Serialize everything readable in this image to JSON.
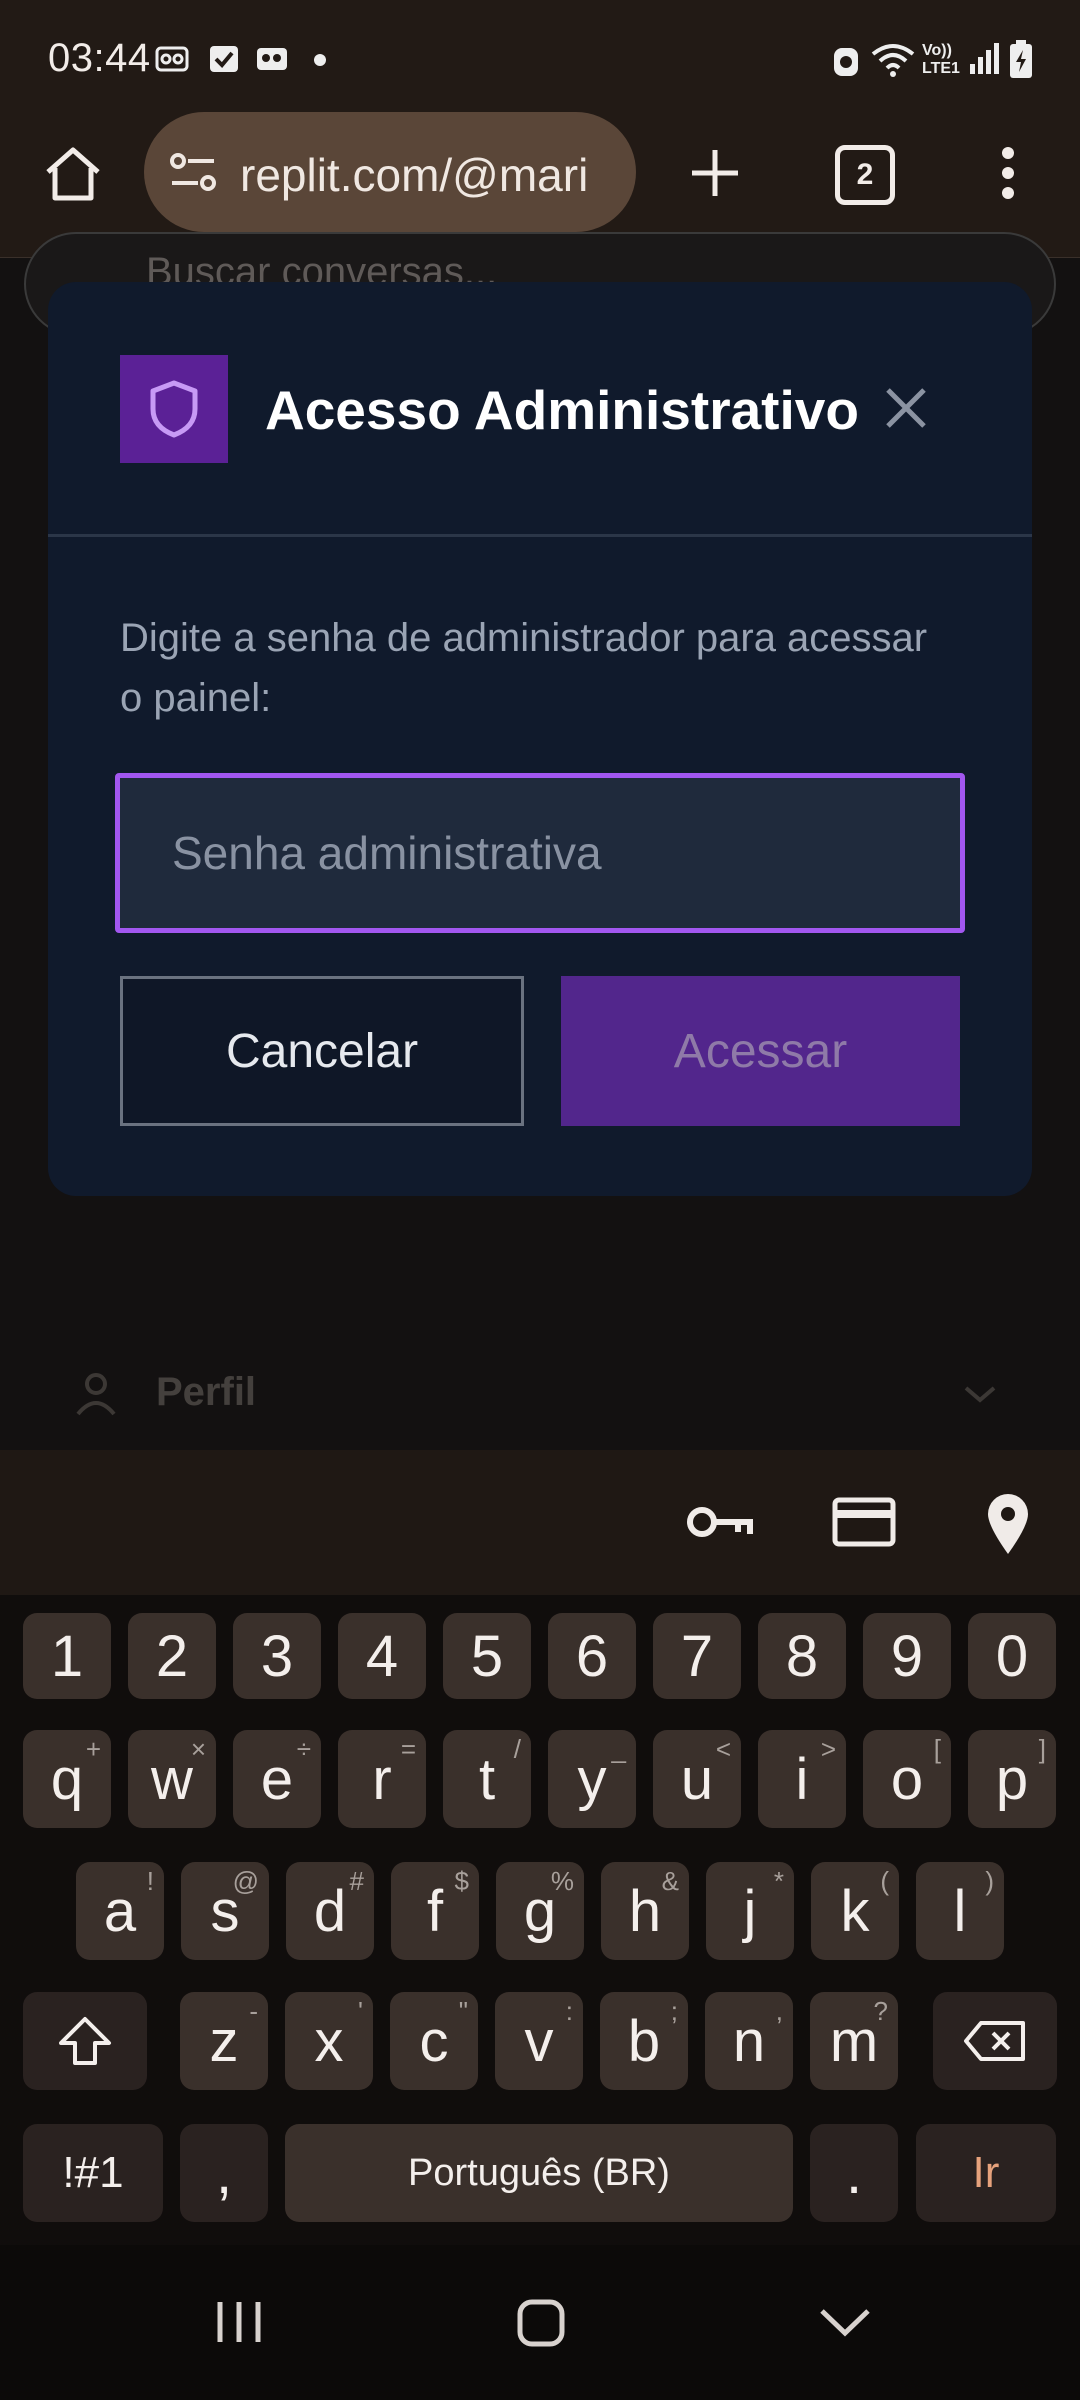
{
  "status_bar": {
    "time": "03:44",
    "left_icons": [
      "voicemail-icon",
      "checkbox-icon",
      "voicemail-alt-icon",
      "dot-icon"
    ],
    "right_icons": [
      "alarm-icon",
      "wifi-icon",
      "volte-icon",
      "signal-icon",
      "battery-charging-icon"
    ],
    "volte_label": "Vo)) LTE1"
  },
  "browser": {
    "url": "replit.com/@mari",
    "tab_count": "2",
    "icons": [
      "home-icon",
      "site-settings-icon",
      "new-tab-icon",
      "tab-switcher-icon",
      "more-menu-icon"
    ]
  },
  "page": {
    "search_placeholder": "Buscar conversas...",
    "profile_label": "Perfil"
  },
  "modal": {
    "title": "Acesso Administrativo",
    "description": "Digite a senha de administrador para acessar o painel:",
    "password_placeholder": "Senha administrativa",
    "cancel_label": "Cancelar",
    "access_label": "Acessar",
    "accent": "#5b2196",
    "input_border": "#a257f0"
  },
  "keyboard": {
    "number_row": [
      "1",
      "2",
      "3",
      "4",
      "5",
      "6",
      "7",
      "8",
      "9",
      "0"
    ],
    "row1": [
      {
        "key": "q",
        "hint": "+"
      },
      {
        "key": "w",
        "hint": "×"
      },
      {
        "key": "e",
        "hint": "÷"
      },
      {
        "key": "r",
        "hint": "="
      },
      {
        "key": "t",
        "hint": "/"
      },
      {
        "key": "y",
        "hint": "_"
      },
      {
        "key": "u",
        "hint": "<"
      },
      {
        "key": "i",
        "hint": ">"
      },
      {
        "key": "o",
        "hint": "["
      },
      {
        "key": "p",
        "hint": "]"
      }
    ],
    "row2": [
      {
        "key": "a",
        "hint": "!"
      },
      {
        "key": "s",
        "hint": "@"
      },
      {
        "key": "d",
        "hint": "#"
      },
      {
        "key": "f",
        "hint": "$"
      },
      {
        "key": "g",
        "hint": "%"
      },
      {
        "key": "h",
        "hint": "&"
      },
      {
        "key": "j",
        "hint": "*"
      },
      {
        "key": "k",
        "hint": "("
      },
      {
        "key": "l",
        "hint": ")"
      }
    ],
    "row3": [
      {
        "key": "z",
        "hint": "-"
      },
      {
        "key": "x",
        "hint": "'"
      },
      {
        "key": "c",
        "hint": "\""
      },
      {
        "key": "v",
        "hint": ":"
      },
      {
        "key": "b",
        "hint": ";"
      },
      {
        "key": "n",
        "hint": ","
      },
      {
        "key": "m",
        "hint": "?"
      }
    ],
    "symbols_label": "!#1",
    "comma": ",",
    "space_label": "Português (BR)",
    "period": ".",
    "go_label": "Ir",
    "accessory_icons": [
      "key-icon",
      "card-icon",
      "location-icon"
    ]
  },
  "nav_bar": {
    "icons": [
      "recents-icon",
      "home-nav-icon",
      "back-hide-keyboard-icon"
    ]
  }
}
